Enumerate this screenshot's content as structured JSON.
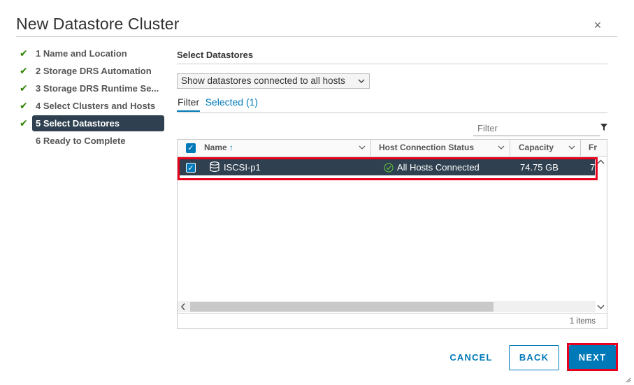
{
  "dialog": {
    "title": "New Datastore Cluster",
    "close_label": "×"
  },
  "steps": [
    {
      "label": "1 Name and Location",
      "done": true
    },
    {
      "label": "2 Storage DRS Automation",
      "done": true
    },
    {
      "label": "3 Storage DRS Runtime Se...",
      "done": true
    },
    {
      "label": "4 Select Clusters and Hosts",
      "done": true
    },
    {
      "label": "5 Select Datastores",
      "done": true,
      "active": true
    },
    {
      "label": "6 Ready to Complete",
      "done": false
    }
  ],
  "content": {
    "section_title": "Select Datastores",
    "dropdown": {
      "selected": "Show datastores connected to all hosts"
    },
    "tabs": {
      "filter": "Filter",
      "selected": "Selected (1)"
    },
    "filter_placeholder": "Filter"
  },
  "grid": {
    "columns": {
      "name": "Name",
      "name_sort": "↑",
      "host_status": "Host Connection Status",
      "capacity": "Capacity",
      "free": "Fr"
    },
    "rows": [
      {
        "name": "ISCSI-p1",
        "host_status": "All Hosts Connected",
        "capacity": "74.75 GB",
        "free": "7",
        "selected": true
      }
    ],
    "footer": "1 items"
  },
  "buttons": {
    "cancel": "CANCEL",
    "back": "BACK",
    "next": "NEXT"
  },
  "colors": {
    "accent": "#0079b8",
    "active_step_bg": "#2f4150",
    "check": "#2f8400",
    "highlight": "#e8001c",
    "ok_status": "#2f8400"
  }
}
